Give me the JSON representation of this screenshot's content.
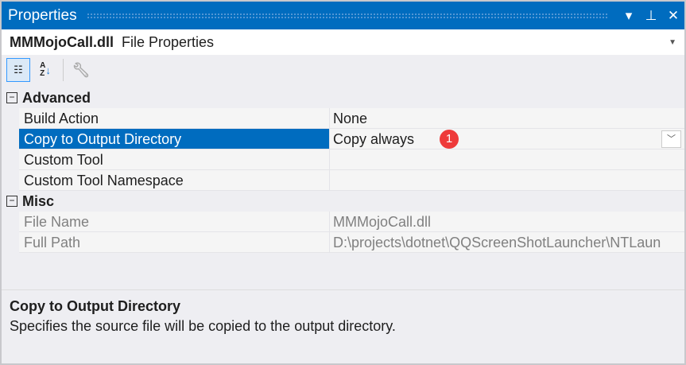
{
  "title": "Properties",
  "title_buttons": {
    "dropdown": "▾",
    "pin": "⊥",
    "close": "X"
  },
  "header": {
    "object": "MMMojoCall.dll",
    "type": "File Properties"
  },
  "toolbar": {
    "categorized": "Categorized",
    "alphabetical": "Alphabetical",
    "property_pages": "Property Pages"
  },
  "categories": [
    {
      "name": "Advanced",
      "toggle": "−",
      "props": [
        {
          "name": "Build Action",
          "value": "None"
        },
        {
          "name": "Copy to Output Directory",
          "value": "Copy always",
          "badge": "1"
        },
        {
          "name": "Custom Tool",
          "value": ""
        },
        {
          "name": "Custom Tool Namespace",
          "value": ""
        }
      ]
    },
    {
      "name": "Misc",
      "toggle": "−",
      "props": [
        {
          "name": "File Name",
          "value": "MMMojoCall.dll"
        },
        {
          "name": "Full Path",
          "value": "D:\\projects\\dotnet\\QQScreenShotLauncher\\NTLaun"
        }
      ]
    }
  ],
  "description": {
    "title": "Copy to Output Directory",
    "text": "Specifies the source file will be copied to the output directory."
  }
}
